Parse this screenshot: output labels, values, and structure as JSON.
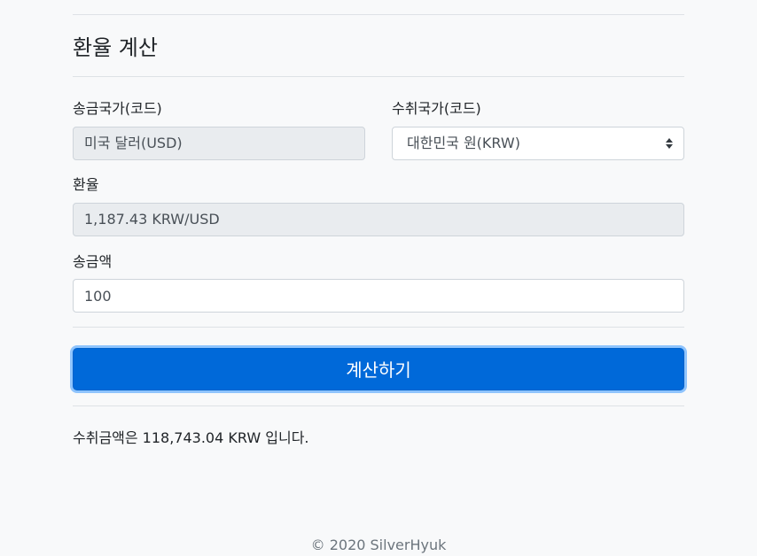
{
  "page": {
    "title": "환율 계산"
  },
  "form": {
    "sender_label": "송금국가(코드)",
    "sender_value": "미국 달러(USD)",
    "receiver_label": "수취국가(코드)",
    "receiver_value": "대한민국 원(KRW)",
    "rate_label": "환율",
    "rate_value": "1,187.43 KRW/USD",
    "amount_label": "송금액",
    "amount_value": "100"
  },
  "actions": {
    "calculate_label": "계산하기"
  },
  "result": {
    "text": "수취금액은 118,743.04 KRW 입니다."
  },
  "footer": {
    "text": "© 2020 SilverHyuk"
  },
  "colors": {
    "primary": "#0069d9",
    "readonly_bg": "#e9ecef",
    "page_bg": "#f8f9fa"
  }
}
